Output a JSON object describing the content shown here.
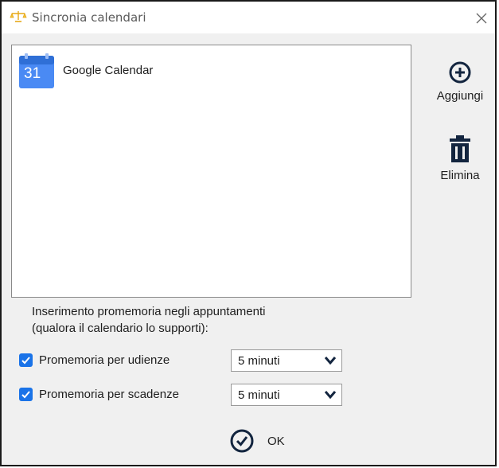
{
  "window": {
    "title": "Sincronia calendari",
    "app_icon": "scales-icon",
    "close_icon": "close-icon"
  },
  "calendars": [
    {
      "name": "Google Calendar",
      "icon": "google-calendar-icon",
      "icon_day": "31"
    }
  ],
  "actions": {
    "add_label": "Aggiungi",
    "add_icon": "plus-circle-icon",
    "delete_label": "Elimina",
    "delete_icon": "trash-icon"
  },
  "reminders": {
    "info_line1": "Inserimento promemoria negli appuntamenti",
    "info_line2": "(qualora il calendario lo supporti):",
    "hearings": {
      "label": "Promemoria per udienze",
      "checked": true,
      "value": "5 minuti"
    },
    "deadlines": {
      "label": "Promemoria per scadenze",
      "checked": true,
      "value": "5 minuti"
    }
  },
  "ok": {
    "label": "OK",
    "icon": "check-circle-icon"
  },
  "colors": {
    "accent": "#1a73e8",
    "dark_icon": "#13253f",
    "window_bg": "#f0f0f0"
  }
}
